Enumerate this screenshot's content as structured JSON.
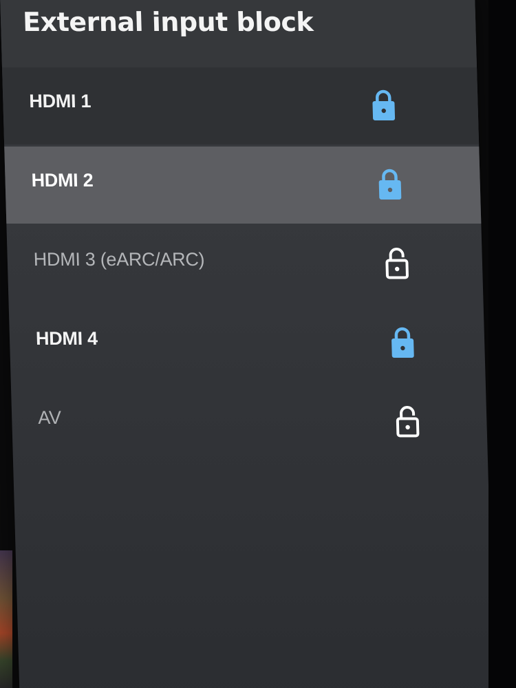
{
  "panel": {
    "title": "External input block"
  },
  "inputs": [
    {
      "label": "HDMI 1",
      "locked": true,
      "icon": "lock-closed-icon"
    },
    {
      "label": "HDMI 2",
      "locked": true,
      "icon": "lock-closed-icon",
      "focused": true
    },
    {
      "label": "HDMI 3 (eARC/ARC)",
      "locked": false,
      "icon": "lock-open-icon"
    },
    {
      "label": "HDMI 4",
      "locked": true,
      "icon": "lock-closed-icon"
    },
    {
      "label": "AV",
      "locked": false,
      "icon": "lock-open-icon"
    }
  ],
  "colors": {
    "panel_bg": "#36383b",
    "row_bg": "#2f3134",
    "focus_bg": "#5d5e62",
    "lock_locked": "#66b8f2",
    "lock_unlocked": "#ffffff",
    "text_primary": "#f4f4f4",
    "text_dim": "#b4b6b9"
  }
}
